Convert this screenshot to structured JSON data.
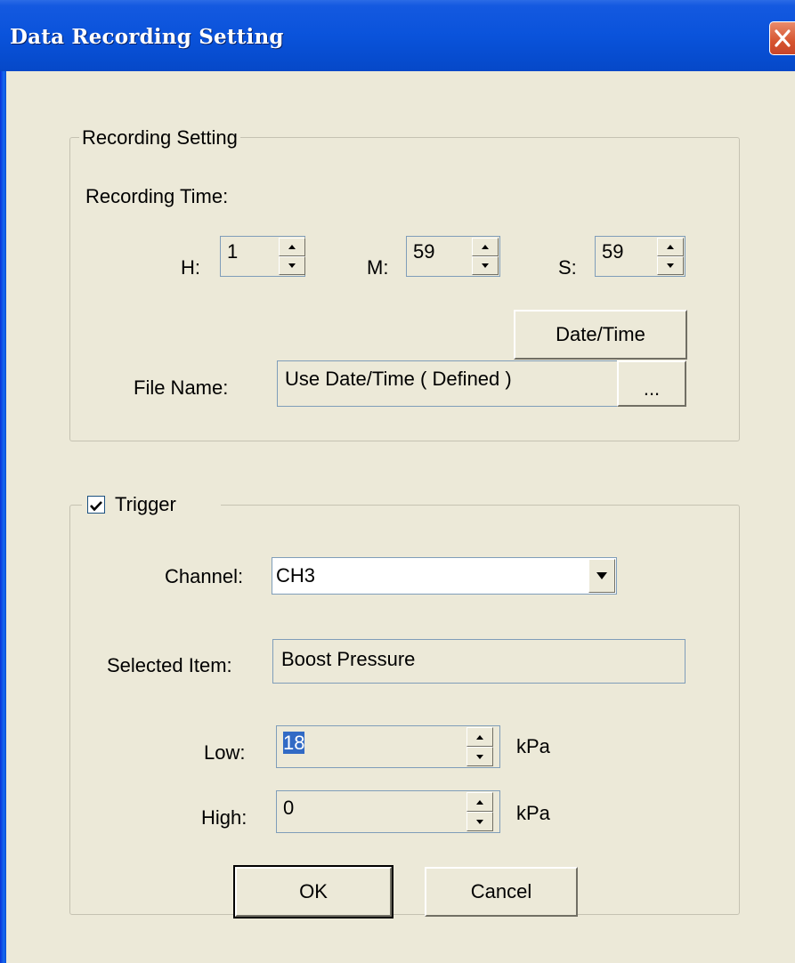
{
  "window": {
    "title": "Data Recording Setting"
  },
  "recording": {
    "group_label": "Recording Setting",
    "time_label": "Recording Time:",
    "hours_label": "H:",
    "hours_value": "1",
    "minutes_label": "M:",
    "minutes_value": "59",
    "seconds_label": "S:",
    "seconds_value": "59",
    "datetime_button": "Date/Time",
    "filename_label": "File Name:",
    "filename_value": "Use Date/Time ( Defined )",
    "browse_button": "..."
  },
  "trigger": {
    "checkbox_label": "Trigger",
    "checked": true,
    "channel_label": "Channel:",
    "channel_value": "CH3",
    "selected_item_label": "Selected Item:",
    "selected_item_value": "Boost Pressure",
    "low_label": "Low:",
    "low_value": "18",
    "low_unit": "kPa",
    "high_label": "High:",
    "high_value": "0",
    "high_unit": "kPa"
  },
  "buttons": {
    "ok": "OK",
    "cancel": "Cancel"
  },
  "colors": {
    "titlebar": "#0A53DB",
    "face": "#ECE9D8",
    "field_border": "#7F9DB9",
    "selection": "#316AC5"
  }
}
